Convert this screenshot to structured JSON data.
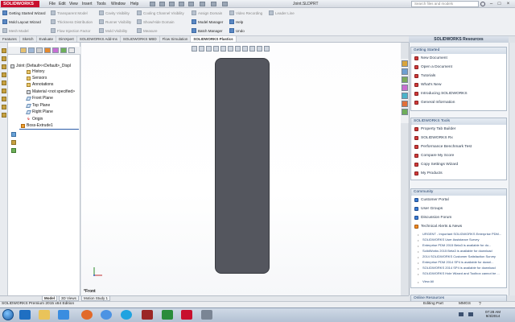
{
  "app": {
    "logo": "SOLIDWORKS",
    "menu": [
      "File",
      "Edit",
      "View",
      "Insert",
      "Tools",
      "Window",
      "Help"
    ],
    "doc_title": "Joint.SLDPRT",
    "search_placeholder": "Search files and models"
  },
  "commands": {
    "col1": [
      "Getting Started Wizard",
      "Mold Layout Wizard",
      "Mesh Model"
    ],
    "col2": [
      "Transparent Model",
      "Thickness Distribution",
      "Flow Injection Factor"
    ],
    "col3": [
      "Cavity Visibility",
      "Runner Visibility",
      "Mold Visibility"
    ],
    "col4": [
      "Cooling Channel Visibility",
      "Show/Hide Domain",
      "Measure"
    ],
    "col5": [
      "Assign Domain",
      "Model Manager",
      "Batch Manager"
    ],
    "col6": [
      "Video Recording",
      "Help",
      "Undo"
    ],
    "col7": [
      "Leader Line"
    ]
  },
  "cm_tabs": [
    "Features",
    "Sketch",
    "Evaluate",
    "DimXpert",
    "SOLIDWORKS Add-Ins",
    "SOLIDWORKS MBD",
    "Flow Simulation",
    "SOLIDWORKS Plastics"
  ],
  "tree": {
    "root": "Joint (Default<<Default>_Displ",
    "items": [
      "History",
      "Sensors",
      "Annotations",
      "Material <not specified>",
      "Front Plane",
      "Top Plane",
      "Right Plane",
      "Origin",
      "Boss-Extrude1"
    ]
  },
  "graphics": {
    "view_label": "*Front"
  },
  "bottom_tabs": [
    "Model",
    "3D Views",
    "Motion Study 1"
  ],
  "status": {
    "left": "SOLIDWORKS Premium 2015 x64 Edition",
    "mode": "Editing Part",
    "units": "MMGS"
  },
  "taskpane": {
    "title": "SOLIDWORKS Resources",
    "getting_started": {
      "header": "Getting Started",
      "links": [
        "New Document",
        "Open a Document",
        "Tutorials",
        "What's New",
        "Introducing SOLIDWORKS",
        "General Information"
      ]
    },
    "tools": {
      "header": "SOLIDWORKS Tools",
      "links": [
        "Property Tab Builder",
        "SOLIDWORKS Rx",
        "Performance Benchmark Test",
        "Compare My Score",
        "Copy Settings Wizard",
        "My Products"
      ]
    },
    "community": {
      "header": "Community",
      "links": [
        "Customer Portal",
        "User Groups",
        "Discussion Forum",
        "Technical Alerts & News"
      ],
      "news": [
        "URGENT - Important SOLIDWORKS Enterprise PDM...",
        "SOLIDWORKS User Assistance Survey",
        "Enterprise PDM 2015 Beta3 is available for do...",
        "SolidWorks 2015 Beta3 is available for download",
        "2014 SOLIDWORKS Customer Satisfaction Survey",
        "Enterprise PDM 2014 SP4 is available for downl...",
        "SOLIDWORKS 2014 SP4 is available for download",
        "SOLIDWORKS Hole Wizard and Toolbox cannot be ..."
      ],
      "view_all": "View All"
    },
    "online": {
      "header": "Online Resources"
    }
  },
  "clock": {
    "time": "07:28 AM",
    "date": "9/4/2014"
  }
}
